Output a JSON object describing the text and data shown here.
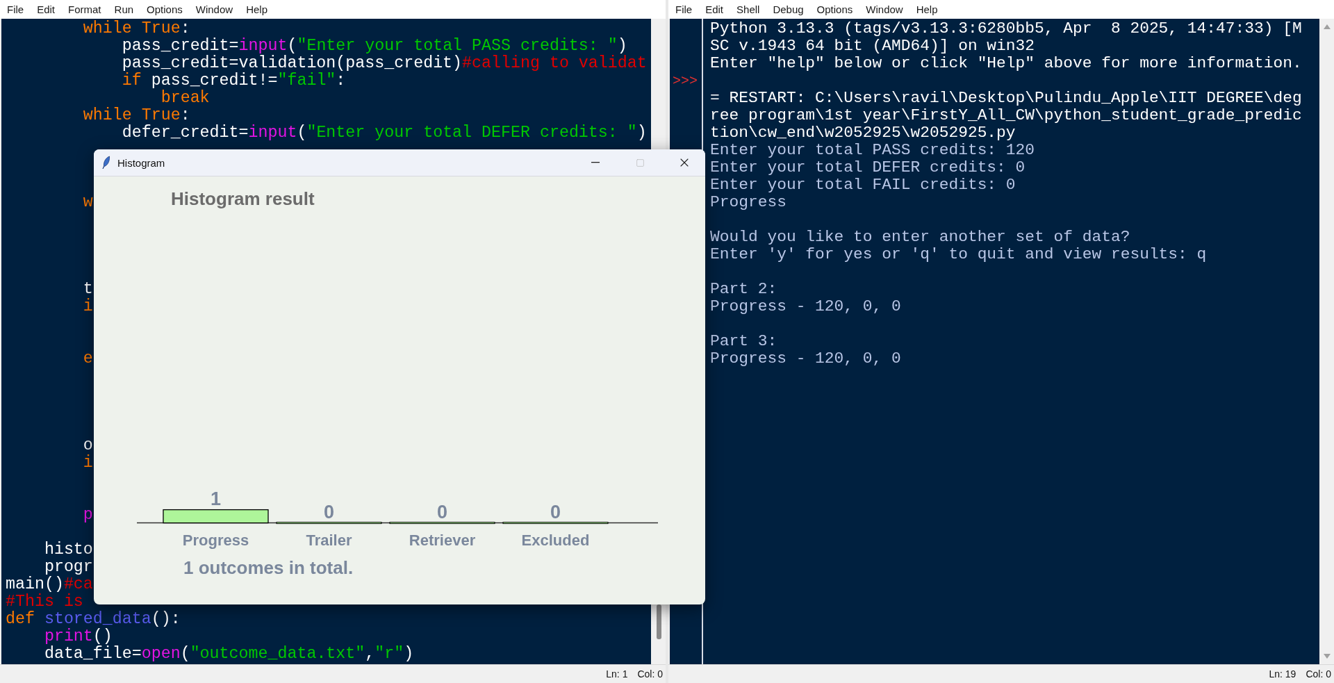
{
  "editor": {
    "menu": [
      "File",
      "Edit",
      "Format",
      "Run",
      "Options",
      "Window",
      "Help"
    ],
    "lines": [
      {
        "kind": "code",
        "tokens": [
          {
            "kind": "keyword",
            "text": "        while True"
          },
          {
            "kind": "plain",
            "text": ":"
          }
        ]
      },
      {
        "kind": "code",
        "tokens": [
          {
            "kind": "plain",
            "text": "            pass_credit="
          },
          {
            "kind": "builtin",
            "text": "input"
          },
          {
            "kind": "plain",
            "text": "("
          },
          {
            "kind": "string",
            "text": "\"Enter your total PASS credits: \""
          },
          {
            "kind": "plain",
            "text": ")"
          }
        ]
      },
      {
        "kind": "code",
        "tokens": [
          {
            "kind": "plain",
            "text": "            pass_credit=validation(pass_credit)"
          },
          {
            "kind": "comment",
            "text": "#calling to validat"
          }
        ]
      },
      {
        "kind": "code",
        "tokens": [
          {
            "kind": "keyword",
            "text": "            if"
          },
          {
            "kind": "plain",
            "text": " pass_credit!="
          },
          {
            "kind": "string",
            "text": "\"fail\""
          },
          {
            "kind": "plain",
            "text": ":"
          }
        ]
      },
      {
        "kind": "code",
        "tokens": [
          {
            "kind": "keyword",
            "text": "                break"
          }
        ]
      },
      {
        "kind": "code",
        "tokens": [
          {
            "kind": "keyword",
            "text": "        while True"
          },
          {
            "kind": "plain",
            "text": ":"
          }
        ]
      },
      {
        "kind": "code",
        "tokens": [
          {
            "kind": "plain",
            "text": "            defer_credit="
          },
          {
            "kind": "builtin",
            "text": "input"
          },
          {
            "kind": "plain",
            "text": "("
          },
          {
            "kind": "string",
            "text": "\"Enter your total DEFER credits: \""
          },
          {
            "kind": "plain",
            "text": ")"
          }
        ]
      },
      {
        "kind": "covered"
      },
      {
        "kind": "covered"
      },
      {
        "kind": "covered"
      },
      {
        "kind": "code",
        "tokens": [
          {
            "kind": "keyword",
            "text": "        w"
          }
        ]
      },
      {
        "kind": "covered"
      },
      {
        "kind": "covered"
      },
      {
        "kind": "covered"
      },
      {
        "kind": "covered"
      },
      {
        "kind": "code",
        "tokens": [
          {
            "kind": "plain",
            "text": "        t"
          }
        ]
      },
      {
        "kind": "code",
        "tokens": [
          {
            "kind": "keyword",
            "text": "        i"
          }
        ]
      },
      {
        "kind": "covered"
      },
      {
        "kind": "covered"
      },
      {
        "kind": "code",
        "tokens": [
          {
            "kind": "keyword",
            "text": "        e"
          }
        ]
      },
      {
        "kind": "covered"
      },
      {
        "kind": "covered"
      },
      {
        "kind": "covered"
      },
      {
        "kind": "covered"
      },
      {
        "kind": "code",
        "tokens": [
          {
            "kind": "plain",
            "text": "        o"
          }
        ]
      },
      {
        "kind": "code",
        "tokens": [
          {
            "kind": "keyword",
            "text": "        i"
          }
        ]
      },
      {
        "kind": "covered"
      },
      {
        "kind": "covered"
      },
      {
        "kind": "code",
        "tokens": [
          {
            "kind": "builtin",
            "text": "        p"
          }
        ]
      },
      {
        "kind": "covered"
      },
      {
        "kind": "code",
        "tokens": [
          {
            "kind": "plain",
            "text": "    histo"
          }
        ]
      },
      {
        "kind": "code",
        "tokens": [
          {
            "kind": "plain",
            "text": "    progr"
          }
        ]
      },
      {
        "kind": "code",
        "tokens": [
          {
            "kind": "plain",
            "text": "main()"
          },
          {
            "kind": "comment",
            "text": "#ca"
          }
        ]
      },
      {
        "kind": "code",
        "tokens": [
          {
            "kind": "comment",
            "text": "#This is"
          }
        ]
      },
      {
        "kind": "code",
        "tokens": [
          {
            "kind": "keyword",
            "text": "def"
          },
          {
            "kind": "definition",
            "text": " stored_data"
          },
          {
            "kind": "plain",
            "text": "():"
          }
        ]
      },
      {
        "kind": "code",
        "tokens": [
          {
            "kind": "builtin",
            "text": "    print"
          },
          {
            "kind": "plain",
            "text": "()"
          }
        ]
      },
      {
        "kind": "code",
        "tokens": [
          {
            "kind": "plain",
            "text": "    data_file="
          },
          {
            "kind": "builtin",
            "text": "open"
          },
          {
            "kind": "plain",
            "text": "("
          },
          {
            "kind": "string",
            "text": "\"outcome_data.txt\""
          },
          {
            "kind": "plain",
            "text": ","
          },
          {
            "kind": "string",
            "text": "\"r\""
          },
          {
            "kind": "plain",
            "text": ")"
          }
        ]
      }
    ],
    "status": {
      "line": "Ln: 1",
      "column": "Col: 0"
    }
  },
  "shell": {
    "menu": [
      "File",
      "Edit",
      "Shell",
      "Debug",
      "Options",
      "Window",
      "Help"
    ],
    "lines": [
      {
        "kind": "banner",
        "text": "Python 3.13.3 (tags/v3.13.3:6280bb5, Apr  8 2025, 14:47:33) [M"
      },
      {
        "kind": "banner",
        "text": "SC v.1943 64 bit (AMD64)] on win32"
      },
      {
        "kind": "banner",
        "text": "Enter \"help\" below or click \"Help\" above for more information."
      },
      {
        "kind": "blank",
        "prompt": ">>>"
      },
      {
        "kind": "banner",
        "text": "= RESTART: C:\\Users\\ravil\\Desktop\\Pulindu_Apple\\IIT DEGREE\\deg"
      },
      {
        "kind": "banner",
        "text": "ree program\\1st year\\FirstY_All_CW\\python_student_grade_predic"
      },
      {
        "kind": "banner",
        "text": "tion\\cw_end\\w2052925\\w2052925.py"
      },
      {
        "kind": "output",
        "text": "Enter your total PASS credits: 120"
      },
      {
        "kind": "output",
        "text": "Enter your total DEFER credits: 0"
      },
      {
        "kind": "output",
        "text": "Enter your total FAIL credits: 0"
      },
      {
        "kind": "output",
        "text": "Progress"
      },
      {
        "kind": "blank"
      },
      {
        "kind": "output",
        "text": "Would you like to enter another set of data?"
      },
      {
        "kind": "output",
        "text": "Enter 'y' for yes or 'q' to quit and view results: q"
      },
      {
        "kind": "blank"
      },
      {
        "kind": "output",
        "text": "Part 2:"
      },
      {
        "kind": "output",
        "text": "Progress - 120, 0, 0"
      },
      {
        "kind": "blank"
      },
      {
        "kind": "output",
        "text": "Part 3:"
      },
      {
        "kind": "output",
        "text": "Progress - 120, 0, 0"
      }
    ],
    "status": {
      "line": "Ln: 19",
      "column": "Col: 0"
    }
  },
  "histogram_window": {
    "title": "Histogram",
    "chart_data": {
      "type": "bar",
      "title": "Histogram result",
      "categories": [
        "Progress",
        "Trailer",
        "Retriever",
        "Excluded"
      ],
      "series": [
        {
          "color": "#aef59a",
          "values": [
            1,
            0,
            0,
            0
          ]
        }
      ],
      "data_labels": true
    },
    "summary": "1 outcomes in total."
  }
}
